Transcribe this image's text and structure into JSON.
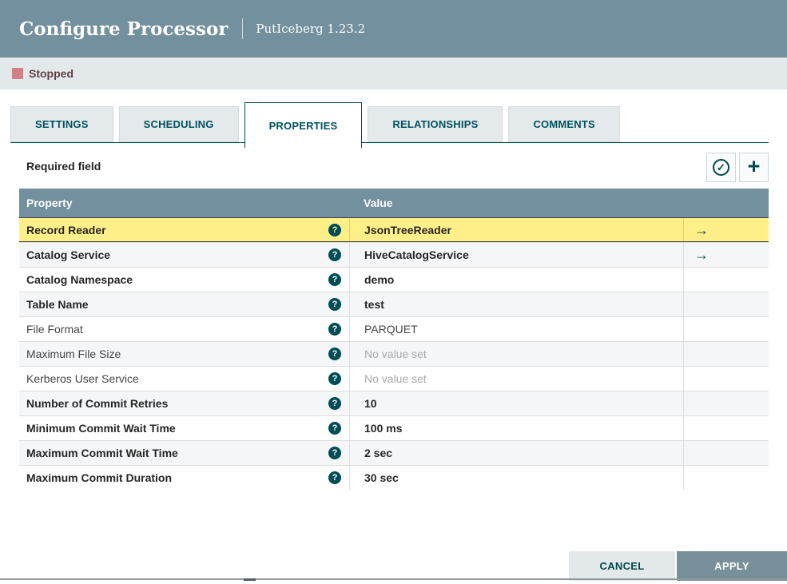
{
  "header": {
    "title": "Configure Processor",
    "subtitle": "PutIceberg 1.23.2"
  },
  "status": {
    "label": "Stopped",
    "color": "#CF8185"
  },
  "tabs": [
    {
      "label": "SETTINGS",
      "active": false
    },
    {
      "label": "SCHEDULING",
      "active": false
    },
    {
      "label": "PROPERTIES",
      "active": true
    },
    {
      "label": "RELATIONSHIPS",
      "active": false
    },
    {
      "label": "COMMENTS",
      "active": false
    }
  ],
  "toolbar": {
    "required_label": "Required field",
    "verify_icon": "check-circle-icon",
    "add_icon": "plus-icon"
  },
  "table": {
    "columns": {
      "property": "Property",
      "value": "Value"
    },
    "rows": [
      {
        "name": "Record Reader",
        "value": "JsonTreeReader",
        "required": true,
        "value_set": true,
        "has_arrow": true,
        "highlighted": true
      },
      {
        "name": "Catalog Service",
        "value": "HiveCatalogService",
        "required": true,
        "value_set": true,
        "has_arrow": true,
        "highlighted": false
      },
      {
        "name": "Catalog Namespace",
        "value": "demo",
        "required": true,
        "value_set": true,
        "has_arrow": false,
        "highlighted": false
      },
      {
        "name": "Table Name",
        "value": "test",
        "required": true,
        "value_set": true,
        "has_arrow": false,
        "highlighted": false
      },
      {
        "name": "File Format",
        "value": "PARQUET",
        "required": false,
        "value_set": true,
        "has_arrow": false,
        "highlighted": false
      },
      {
        "name": "Maximum File Size",
        "value": "No value set",
        "required": false,
        "value_set": false,
        "has_arrow": false,
        "highlighted": false
      },
      {
        "name": "Kerberos User Service",
        "value": "No value set",
        "required": false,
        "value_set": false,
        "has_arrow": false,
        "highlighted": false
      },
      {
        "name": "Number of Commit Retries",
        "value": "10",
        "required": true,
        "value_set": true,
        "has_arrow": false,
        "highlighted": false
      },
      {
        "name": "Minimum Commit Wait Time",
        "value": "100 ms",
        "required": true,
        "value_set": true,
        "has_arrow": false,
        "highlighted": false
      },
      {
        "name": "Maximum Commit Wait Time",
        "value": "2 sec",
        "required": true,
        "value_set": true,
        "has_arrow": false,
        "highlighted": false
      },
      {
        "name": "Maximum Commit Duration",
        "value": "30 sec",
        "required": true,
        "value_set": true,
        "has_arrow": false,
        "highlighted": false
      }
    ]
  },
  "footer": {
    "cancel_label": "CANCEL",
    "apply_label": "APPLY"
  },
  "colors": {
    "header_bg": "#72909D",
    "accent_teal": "#004849",
    "highlight_row": "#FFEF89",
    "status_bg": "#E3E8EA",
    "stopped_red": "#CF8185",
    "alt_row": "#F4F6F7"
  }
}
